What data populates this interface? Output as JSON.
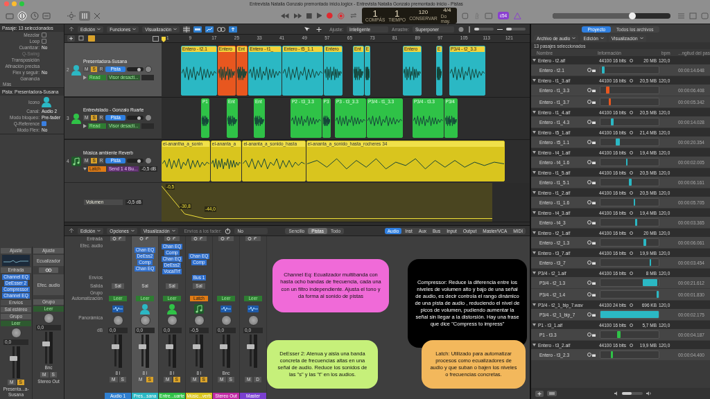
{
  "window": {
    "title": "Entrevista Natalia  Gonzalo premontado inicio.logicx - Entrevista Natalia  Gonzalo premontado inicio - Pistas"
  },
  "lcd": {
    "bar": "1",
    "beat": "1",
    "bar_label": "COMPÁS",
    "beat_label": "TIEMPO",
    "tempo": "120",
    "tempo_label": "CONSERVAR",
    "signature": "4/4",
    "key": "Do may."
  },
  "badge": "c54",
  "master_volume": {
    "level": 0.68
  },
  "inspector": {
    "region_header": "Pasaje: 13 seleccionados",
    "region_rows": [
      {
        "label": "Mezclar",
        "kind": "check",
        "checked": false
      },
      {
        "label": "Loop",
        "kind": "check",
        "checked": false
      },
      {
        "label": "Cuantizar:",
        "value": "No",
        "kind": "value"
      },
      {
        "label": "Q-Swing",
        "kind": "disabled"
      },
      {
        "label": "Transposición",
        "kind": "value"
      },
      {
        "label": "Afinación precisa",
        "kind": "value"
      },
      {
        "label": "Flex y seguir:",
        "value": "No",
        "kind": "value"
      },
      {
        "label": "Ganancia",
        "kind": "value"
      }
    ],
    "more": "Más",
    "track_header": "Pista: Presentadora-Susana",
    "track_rows": [
      {
        "label": "Icono",
        "kind": "icon"
      },
      {
        "label": "Canal:",
        "value": "Audio 2",
        "kind": "value"
      },
      {
        "label": "Modo bloqueo:",
        "value": "Pre-fader",
        "kind": "value"
      },
      {
        "label": "Q-Reference",
        "kind": "check",
        "checked": true
      },
      {
        "label": "Modo Flex:",
        "value": "No",
        "kind": "value"
      }
    ],
    "strips": [
      {
        "setting": "Ajuste",
        "input": "Entrada",
        "plugins": [
          "Channel EQ",
          "DeEsser 2",
          "Compressor",
          "Channel EQ"
        ],
        "sends": "Envíos",
        "output": "Sal estéreo",
        "group": "Grupo",
        "automation": "Leer",
        "pan_value": "0,0",
        "buttons": [
          {
            "label": "M",
            "on": false
          },
          {
            "label": "S",
            "on": true
          }
        ],
        "name": "Presenta...a-Susana"
      },
      {
        "setting": "Ajuste",
        "eq": "Ecualizador",
        "effects": "Efec. audio",
        "group": "Grupo",
        "automation": "Leer",
        "pan_value": "0,0",
        "meter_label": "Bnc",
        "buttons": [
          {
            "label": "M",
            "on": false
          },
          {
            "label": "S",
            "on": false
          }
        ],
        "name": "Stereo Out"
      }
    ]
  },
  "tracks_toolbar": {
    "vertical_zoom": {
      "level": 0.25
    },
    "horizontal_zoom": {
      "level": 0.3
    },
    "menus": [
      "Edición",
      "Funciones",
      "Visualización"
    ],
    "snap_label": "Ajuste:",
    "snap": "Inteligente",
    "drag_label": "Arrastre:",
    "drag": "Superponer"
  },
  "ruler": [
    "1",
    "9",
    "17",
    "25",
    "33",
    "41",
    "49",
    "57",
    "65",
    "73",
    "81",
    "89",
    "97",
    "105",
    "113",
    "121"
  ],
  "tracks": [
    {
      "number": "2",
      "name": "Presentadora-Susana",
      "kind": "person",
      "color": "#2bb8c4",
      "selected": true,
      "buttons": [
        {
          "label": "M",
          "on": false
        },
        {
          "label": "S",
          "on": true
        },
        {
          "label": "R",
          "on": false
        }
      ],
      "mode": "Pista",
      "automation": {
        "label": "Read",
        "kind": "read"
      },
      "param": "Visor desacti...",
      "regions": [
        {
          "label": "Entero - t2.1",
          "color": "#2bb8c4"
        },
        {
          "label": "Entero",
          "color": "#e8571f"
        },
        {
          "label": "Ent",
          "color": "#e8571f"
        },
        {
          "label": "Entero - t1_",
          "color": "#2bb8c4"
        },
        {
          "label": "Entero - t5_1.1",
          "color": "#2bb8c4"
        },
        {
          "label": "Entero",
          "color": "#2bb8c4"
        },
        {
          "label": "Ent",
          "color": "#2bb8c4"
        },
        {
          "label": "E",
          "color": "#2bb8c4"
        },
        {
          "label": "Entero",
          "color": "#2bb8c4"
        },
        {
          "label": "E",
          "color": "#2bb8c4"
        },
        {
          "label": "P3/4 - t2_3.3",
          "color": "#2bb8c4"
        }
      ]
    },
    {
      "number": "3",
      "name": "Entrevistado - Gonzalo Ruarte",
      "kind": "person",
      "color": "#2fc247",
      "selected": false,
      "buttons": [
        {
          "label": "M",
          "on": false
        },
        {
          "label": "S",
          "on": true
        },
        {
          "label": "R",
          "on": false
        }
      ],
      "mode": "Pista",
      "automation": {
        "label": "Read",
        "kind": "read"
      },
      "param": "Visor desacti...",
      "regions": [
        {
          "label": "P1",
          "color": "#2fc247"
        },
        {
          "label": "Ent",
          "color": "#2fc247"
        },
        {
          "label": "Ent",
          "color": "#2fc247"
        },
        {
          "label": "P2 - t3_3.3",
          "color": "#2fc247"
        },
        {
          "label": "P3",
          "color": "#2fc247"
        },
        {
          "label": "P3 - t3_3.3",
          "color": "#2fc247"
        },
        {
          "label": "P3/4 - t1_3.3",
          "color": "#2fc247"
        },
        {
          "label": "P3/4 - t3.3",
          "color": "#2fc247"
        },
        {
          "label": "P3/4",
          "color": "#2fc247"
        }
      ]
    },
    {
      "number": "4",
      "name": "Música ambiente Reverb",
      "kind": "music",
      "selected": false,
      "buttons": [
        {
          "label": "M",
          "on": false
        },
        {
          "label": "S",
          "on": true
        },
        {
          "label": "R",
          "on": false
        }
      ],
      "mode": "Pista",
      "automation": {
        "label": "Latch",
        "kind": "latch"
      },
      "param": "Send 1 4 Bu...",
      "value": "-0,5 dB",
      "regions": [
        {
          "label": "el-anantha_a_sonin",
          "color": "#d9c51e"
        },
        {
          "label": "el-ananta_a",
          "color": "#d9c51e"
        },
        {
          "label": "el-ananta_a_sonido_hasta",
          "color": "#d9c51e"
        },
        {
          "label": "el-ananta_a_sonido_hasta_rocheres 34",
          "color": "#d9c51e"
        }
      ],
      "lane": {
        "param": "Volumen",
        "value": "-0,5 dB",
        "points": [
          "-0,5",
          "-30,8",
          "-44,0"
        ]
      }
    }
  ],
  "mixer": {
    "menus": [
      "Edición",
      "Opciones",
      "Visualización"
    ],
    "sends_label": "Envíos a los fader:",
    "sends_value": "No",
    "views": [
      {
        "label": "Sencillo",
        "selected": false
      },
      {
        "label": "Pistas",
        "selected": true
      },
      {
        "label": "Todo",
        "selected": false
      }
    ],
    "filters": [
      {
        "label": "Audio",
        "selected": true
      },
      {
        "label": "Inst",
        "selected": false
      },
      {
        "label": "Aux",
        "selected": false
      },
      {
        "label": "Bus",
        "selected": false
      },
      {
        "label": "Input",
        "selected": false
      },
      {
        "label": "Output",
        "selected": false
      },
      {
        "label": "Master/VCA",
        "selected": false
      },
      {
        "label": "MIDI",
        "selected": false
      }
    ],
    "row_labels": [
      "Entrada",
      "Efec. audio",
      "Envíos",
      "Salida",
      "Grupo",
      "Automatización",
      "Panorámica",
      "dB"
    ],
    "strips": [
      {
        "name": "Audio 1",
        "color": "#2f7fd0",
        "kind": "wave",
        "output": "Sal",
        "automation": {
          "label": "Leer",
          "kind": "read"
        },
        "db": "0,0",
        "meter": "8 I",
        "buttons": [
          {
            "label": "M",
            "on": false
          },
          {
            "label": "S",
            "on": false
          }
        ],
        "selected": false
      },
      {
        "name": "Pres...sana",
        "color": "#2bb8c4",
        "kind": "person",
        "plugins": [
          "Chan EQ",
          "DeEss2",
          "Comp",
          "Chan EQ"
        ],
        "output": "Sal",
        "automation": {
          "label": "Leer",
          "kind": "read"
        },
        "db": "0,0",
        "meter": "8 I",
        "buttons": [
          {
            "label": "M",
            "on": false
          },
          {
            "label": "S",
            "on": true
          }
        ],
        "selected": true
      },
      {
        "name": "Entre...uarte",
        "color": "#2fc247",
        "kind": "person",
        "plugins": [
          "Chan EQ",
          "Comp",
          "Chan EQ",
          "DeEss2",
          "VocalTrf"
        ],
        "output": "Sal",
        "automation": {
          "label": "Leer",
          "kind": "read"
        },
        "db": "0,0",
        "meter": "8 I",
        "buttons": [
          {
            "label": "M",
            "on": false
          },
          {
            "label": "S",
            "on": true
          }
        ],
        "selected": false
      },
      {
        "name": "Músic...verb",
        "color": "#d9c51e",
        "kind": "music",
        "plugins": [
          "Chan EQ",
          "Comp"
        ],
        "send": "Bus 1",
        "output": "Sal",
        "automation": {
          "label": "Latch",
          "kind": "latch"
        },
        "db": "-0,5",
        "meter": "8 I",
        "buttons": [
          {
            "label": "M",
            "on": false
          },
          {
            "label": "S",
            "on": true
          }
        ],
        "selected": false
      },
      {
        "name": "Stereo Out",
        "color": "#c22aa5",
        "kind": "wave",
        "automation": {
          "label": "Leer",
          "kind": "read"
        },
        "db": "0,0",
        "meter": "Bnc",
        "buttons": [
          {
            "label": "M",
            "on": false
          },
          {
            "label": "S",
            "on": false
          }
        ],
        "selected": false
      },
      {
        "name": "Master",
        "color": "#7a3fd0",
        "kind": "wave",
        "automation": {
          "label": "Leer",
          "kind": "read"
        },
        "db": "0,0",
        "buttons": [
          {
            "label": "M",
            "on": false
          },
          {
            "label": "D",
            "on": false
          }
        ],
        "selected": false
      }
    ],
    "notes": [
      {
        "text": "Channel Eq: Ecualizador multibanda con hasta ocho bandas de frecuencia, cada una con un filtro independiente.  Ajusta el tono y da forma al sonido de pistas",
        "color": "#f06ad8"
      },
      {
        "text": "Compressor: Reduce la diferencia entre los niveles de volumen alto y bajo de una señal de audio, es decir controla el rango dinámico de una pista de audio , reduciendo el nivel de picos de volumen, pudiendo aumentar la señal sin llegar a la distorsión. Hay una frase que dice \"Compress to impress\"",
        "color": "#000000"
      },
      {
        "text": "DeEsser 2: Atenua y aisla una banda concreta de frecuencias altas en una señal de audio. Reduce los sonidos de las \"s\" y las \"t\" en los audios.",
        "color": "#c6f07a"
      },
      {
        "text": "Latch:  Utilizado para automatizar procesos como ecualizadores de audio y que suban o bajen los niveles o frecuencias concretas.",
        "color": "#f3b85c"
      }
    ]
  },
  "browser": {
    "preview_volume": {
      "level": 0.45
    },
    "tabs": [
      {
        "label": "Proyecto",
        "selected": true
      },
      {
        "label": "Todos los archivos",
        "selected": false
      }
    ],
    "menus": [
      "Archivo de audio",
      "Edición",
      "Visualización"
    ],
    "summary": "13 pasajes seleccionados",
    "columns": [
      "Nombre",
      "Información",
      "bpm",
      "...ngitud del pas"
    ],
    "files": [
      {
        "name": "Entero - t2.aif",
        "info": "44100 16 bits",
        "size": "20 MB",
        "bpm": "120,0",
        "children": [
          {
            "name": "Entero - t2.1",
            "length": "00:00:14.648",
            "color": "#2bb8c4"
          }
        ]
      },
      {
        "name": "Entero - t1_3.aif",
        "info": "44100 16 bits",
        "size": "20,5 MB",
        "bpm": "120,0",
        "children": [
          {
            "name": "Entero - t1_3.3",
            "length": "00:00:06.408",
            "color": "#e8571f"
          },
          {
            "name": "Entero - t1_3.7",
            "length": "00:00:05.342",
            "color": "#e8571f"
          }
        ]
      },
      {
        "name": "Entero - t1_4.aif",
        "info": "44100 16 bits",
        "size": "20,5 MB",
        "bpm": "120,0",
        "children": [
          {
            "name": "Entero - t1_4.3",
            "length": "00:00:14.028",
            "color": "#2bb8c4"
          }
        ]
      },
      {
        "name": "Entero - t5_1.aif",
        "info": "44100 16 bits",
        "size": "21,4 MB",
        "bpm": "120,0",
        "children": [
          {
            "name": "Entero - t5_1.1",
            "length": "00:00:20.354",
            "color": "#2bb8c4"
          }
        ]
      },
      {
        "name": "Entero - t4_1.aif",
        "info": "44100 16 bits",
        "size": "19,4 MB",
        "bpm": "120,0",
        "children": [
          {
            "name": "Entero - t4_1.6",
            "length": "00:00:02.005",
            "color": "#2bb8c4"
          }
        ]
      },
      {
        "name": "Entero - t1_5.aif",
        "info": "44100 16 bits",
        "size": "20,5 MB",
        "bpm": "120,0",
        "children": [
          {
            "name": "Entero - t1_5.1",
            "length": "00:00:06.161",
            "color": "#2bb8c4"
          }
        ]
      },
      {
        "name": "Entero - t1_2.aif",
        "info": "44100 16 bits",
        "size": "20,5 MB",
        "bpm": "120,0",
        "children": [
          {
            "name": "Entero - t1_1.6",
            "length": "00:00:05.705",
            "color": "#2bb8c4"
          }
        ]
      },
      {
        "name": "Entero - t4_3.aif",
        "info": "44100 16 bits",
        "size": "19,4 MB",
        "bpm": "120,0",
        "children": [
          {
            "name": "Entero - t4_3",
            "length": "00:00:03.365",
            "color": "#2bb8c4"
          }
        ]
      },
      {
        "name": "Entero - t2_1.aif",
        "info": "44100 16 bits",
        "size": "20 MB",
        "bpm": "120,0",
        "children": [
          {
            "name": "Entero - t2_1.3",
            "length": "00:00:06.061",
            "color": "#2bb8c4"
          }
        ]
      },
      {
        "name": "Entero - t3_7.aif",
        "info": "44100 16 bits",
        "size": "19,9 MB",
        "bpm": "120,0",
        "children": [
          {
            "name": "Entero - t3_7",
            "length": "00:00:03.454",
            "color": "#2bb8c4"
          }
        ]
      },
      {
        "name": "P3/4 - t2_1.aif",
        "info": "44100 16 bits",
        "size": "8 MB",
        "bpm": "120,0",
        "children": [
          {
            "name": "P3/4 - t2_1.3",
            "length": "00:00:21.612",
            "color": "#2bb8c4"
          },
          {
            "name": "P3/4 - t2_1.4",
            "length": "00:00:01.830",
            "color": "#2bb8c4"
          }
        ]
      },
      {
        "name": "P3/4 - t2_1_bip_7.wav",
        "info": "44100 24 bits",
        "size": "696 KB",
        "bpm": "120,0",
        "children": [
          {
            "name": "P3/4 - t2_1_bip_7",
            "length": "00:00:02.175",
            "color": "#2bb8c4"
          }
        ]
      },
      {
        "name": "P1 - t3_1.aif",
        "info": "44100 16 bits",
        "size": "5,7 MB",
        "bpm": "120,0",
        "children": [
          {
            "name": "P1 - t3.3",
            "length": "00:00:04.187",
            "color": "#2fc247"
          }
        ]
      },
      {
        "name": "Entero - t3_2.aif",
        "info": "44100 16 bits",
        "size": "19,9 MB",
        "bpm": "120,0",
        "children": [
          {
            "name": "Entero - t3_2.3",
            "length": "00:00:04.400",
            "color": "#2fc247"
          }
        ]
      }
    ]
  }
}
